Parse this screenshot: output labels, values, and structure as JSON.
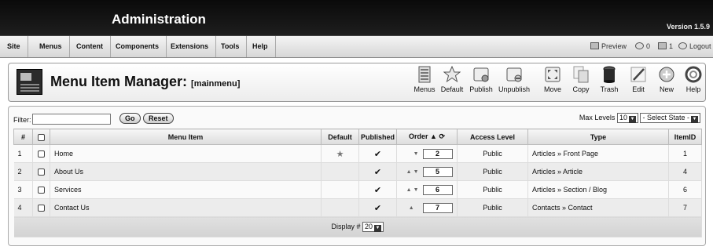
{
  "app": {
    "title": "Administration",
    "version": "Version 1.5.9"
  },
  "menubar": {
    "items": [
      "Site",
      "Menus",
      "Content",
      "Components",
      "Extensions",
      "Tools",
      "Help"
    ],
    "preview": "Preview",
    "messages": "0",
    "users": "1",
    "logout": "Logout"
  },
  "header": {
    "title": "Menu Item Manager:",
    "subtitle": "[mainmenu]"
  },
  "toolbar": [
    {
      "label": "Menus",
      "icon": "menus-icon"
    },
    {
      "label": "Default",
      "icon": "star-icon"
    },
    {
      "label": "Publish",
      "icon": "publish-icon"
    },
    {
      "label": "Unpublish",
      "icon": "unpublish-icon"
    },
    {
      "label": "Move",
      "icon": "move-icon"
    },
    {
      "label": "Copy",
      "icon": "copy-icon"
    },
    {
      "label": "Trash",
      "icon": "trash-icon"
    },
    {
      "label": "Edit",
      "icon": "edit-icon"
    },
    {
      "label": "New",
      "icon": "new-icon"
    },
    {
      "label": "Help",
      "icon": "help-icon"
    }
  ],
  "filter": {
    "label": "Filter:",
    "value": "",
    "go": "Go",
    "reset": "Reset",
    "max_levels_label": "Max Levels",
    "max_levels_value": "10",
    "state_value": "- Select State -"
  },
  "table": {
    "headers": [
      "#",
      "",
      "Menu Item",
      "Default",
      "Published",
      "Order",
      "Access Level",
      "Type",
      "ItemID"
    ],
    "rows": [
      {
        "num": "1",
        "name": "Home",
        "default": true,
        "order": "2",
        "up": false,
        "down": true,
        "access": "Public",
        "type": "Articles » Front Page",
        "id": "1"
      },
      {
        "num": "2",
        "name": "About Us",
        "default": false,
        "order": "5",
        "up": true,
        "down": true,
        "access": "Public",
        "type": "Articles » Article",
        "id": "4"
      },
      {
        "num": "3",
        "name": "Services",
        "default": false,
        "order": "6",
        "up": true,
        "down": true,
        "access": "Public",
        "type": "Articles » Section / Blog",
        "id": "6"
      },
      {
        "num": "4",
        "name": "Contact Us",
        "default": false,
        "order": "7",
        "up": true,
        "down": false,
        "access": "Public",
        "type": "Contacts » Contact",
        "id": "7"
      }
    ]
  },
  "footer": {
    "display_label": "Display #",
    "display_value": "20"
  },
  "colors": {
    "topbar": "#111111",
    "menubar": "#e4e4e4"
  }
}
